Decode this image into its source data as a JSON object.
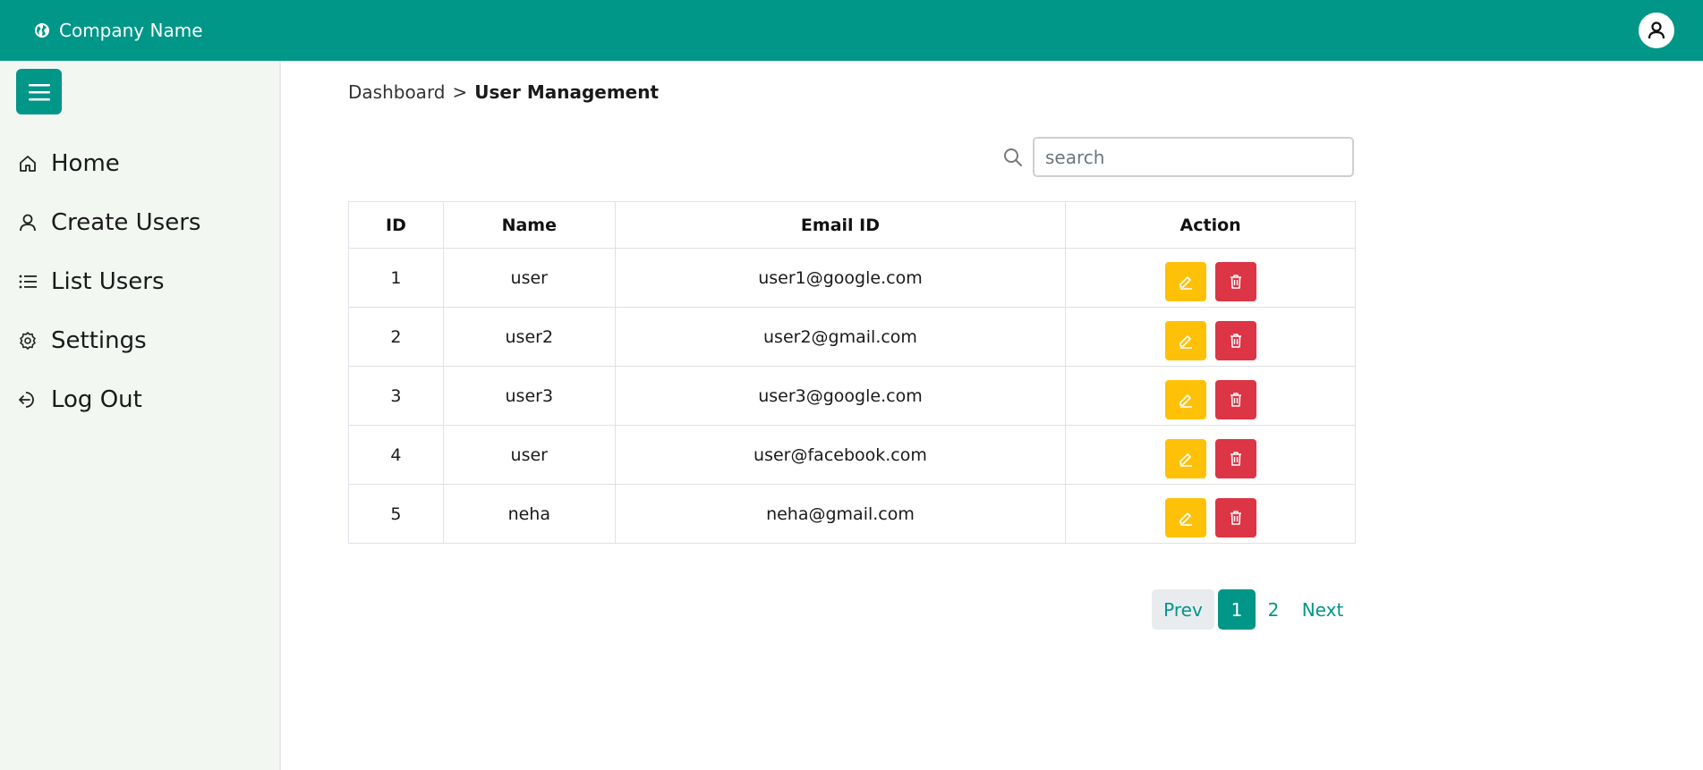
{
  "header": {
    "brand_name": "Company Name",
    "brand_icon": "globe-icon",
    "profile_icon": "user-circle-icon",
    "color": "#009688"
  },
  "sidebar": {
    "toggle_icon": "hamburger-menu-icon",
    "items": [
      {
        "label": "Home",
        "icon": "home-icon"
      },
      {
        "label": "Create Users",
        "icon": "user-icon"
      },
      {
        "label": "List Users",
        "icon": "list-icon"
      },
      {
        "label": "Settings",
        "icon": "gear-icon"
      },
      {
        "label": "Log Out",
        "icon": "logout-icon"
      }
    ]
  },
  "breadcrumb": {
    "parent": "Dashboard",
    "separator": ">",
    "current": "User Management"
  },
  "search": {
    "placeholder": "search",
    "value": ""
  },
  "table": {
    "headers": [
      "ID",
      "Name",
      "Email ID",
      "Action"
    ],
    "rows": [
      {
        "id": "1",
        "name": "user",
        "email": "user1@google.com"
      },
      {
        "id": "2",
        "name": "user2",
        "email": "user2@gmail.com"
      },
      {
        "id": "3",
        "name": "user3",
        "email": "user3@google.com"
      },
      {
        "id": "4",
        "name": "user",
        "email": "user@facebook.com"
      },
      {
        "id": "5",
        "name": "neha",
        "email": "neha@gmail.com"
      }
    ],
    "edit_color": "#ffc107",
    "delete_color": "#dc3545"
  },
  "pagination": {
    "prev_label": "Prev",
    "pages": [
      "1",
      "2"
    ],
    "active_page": "1",
    "next_label": "Next"
  }
}
